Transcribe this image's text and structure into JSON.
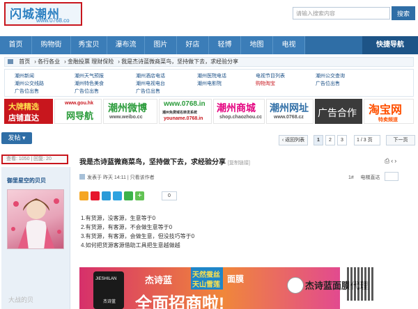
{
  "header": {
    "logo_main": "闪城潮州",
    "logo_url": "www.0768.co",
    "search_placeholder": "请输入搜索内容",
    "search_button": "搜索"
  },
  "nav": {
    "items": [
      "首页",
      "购物街",
      "秀宝贝",
      "瀑布流",
      "图片",
      "好店",
      "轻博",
      "地图",
      "电视"
    ],
    "quick": "快捷导航"
  },
  "breadcrumb": [
    "首页",
    "各行各业",
    "金融投票 理财保险",
    "我是杰诗蓝微商菜鸟，坚持做下去，求经验分享"
  ],
  "links": [
    [
      "潮州新闻",
      "潮州天气预报",
      "潮州酒店电话",
      "潮州医院电话",
      "电视节目列表",
      "潮州公交查询"
    ],
    [
      "潮州公交线路",
      "潮州特色美食",
      "潮州电视电台",
      "潮州电影院",
      "购物淘宝",
      "广告位出售"
    ],
    [
      "广告位出售",
      "广告位出售",
      "广告位出售"
    ]
  ],
  "banners": {
    "b1_line1": "大牌精选",
    "b1_line2": "店铺直达",
    "b2_url": "www.gou.hk",
    "b2_text": "网导航",
    "b3_title": "潮州微博",
    "b3_url": "www.weibo.cc",
    "b4_url": "www.0768.in",
    "b4_sub": "潮州免费域名转发系统",
    "b4_url2": "youname.0768.in",
    "b5_title": "潮州商城",
    "b5_url": "shop.chaozhou.cc",
    "b6_title": "潮州网址",
    "b6_url": "www.0768.cz",
    "b7_text": "广告合作",
    "b8_title": "淘宝网",
    "b8_sub": "特卖频道"
  },
  "toolbar": {
    "post_button": "发帖",
    "back_button": "返回列表",
    "pages": [
      "1",
      "2",
      "3"
    ],
    "page_input": "1",
    "page_total": "/ 3 页",
    "next_button": "下一页"
  },
  "thread": {
    "stats": "查看: 1050 | 回复: 20",
    "title": "我是杰诗蓝微商菜鸟，坚持做下去，求经验分享",
    "copy_link": "[复制链接]"
  },
  "author": {
    "name": "御里星空的贝贝"
  },
  "post": {
    "meta": "发表于 昨天 14:11 | 只看该作者",
    "floor": "1#",
    "floor_jump": "电梯直达",
    "share_count": "0",
    "lines": [
      "1.有货源，没客源，生意等于0",
      "2.有货源，有客源，不会做生意等于0",
      "3.有货源，有客源，会做生意，但没技巧等于0",
      "4.如何把货源客源借助工具把生意越做越"
    ]
  },
  "ad": {
    "logo_text": "JIESHILAN",
    "logo_sub": "杰诗蓝",
    "brand": "杰诗蓝",
    "slogan1": "天然蚕丝",
    "slogan2": "天山雪莲",
    "product": "面膜",
    "headline": "全面招商啦!"
  },
  "watermarks": {
    "left": "大战的贝",
    "right": "杰诗蓝面膜代理"
  },
  "colors": {
    "brand_blue": "#2f6ea6",
    "highlight_red": "#c8161d"
  }
}
